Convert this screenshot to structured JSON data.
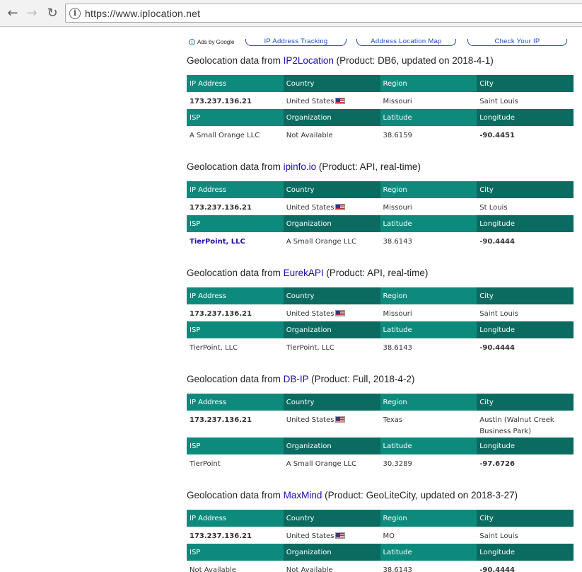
{
  "browser": {
    "url": "https://www.iplocation.net"
  },
  "ads": {
    "label": "Ads by Google",
    "links": [
      "IP Address Tracking",
      "Address Location Map",
      "Check Your IP"
    ]
  },
  "headers": {
    "ip": "IP Address",
    "country": "Country",
    "region": "Region",
    "city": "City",
    "isp": "ISP",
    "org": "Organization",
    "lat": "Latitude",
    "lon": "Longitude"
  },
  "title_prefix": "Geolocation data from ",
  "sections": [
    {
      "source": "IP2Location",
      "product": "(Product: DB6, updated on 2018-4-1)",
      "ip": "173.237.136.21",
      "country": "United States",
      "region": "Missouri",
      "city": "Saint Louis",
      "isp": "A Small Orange LLC",
      "org": "Not Available",
      "lat": "38.6159",
      "lon": "-90.4451"
    },
    {
      "source": "ipinfo.io",
      "product": "(Product: API, real-time)",
      "ip": "173.237.136.21",
      "country": "United States",
      "region": "Missouri",
      "city": "St Louis",
      "isp": "TierPoint, LLC",
      "org": "A Small Orange LLC",
      "lat": "38.6143",
      "lon": "-90.4444"
    },
    {
      "source": "EurekAPI",
      "product": "(Product: API, real-time)",
      "ip": "173.237.136.21",
      "country": "United States",
      "region": "Missouri",
      "city": "Saint Louis",
      "isp": "TierPoint, LLC",
      "org": "TierPoint, LLC",
      "lat": "38.6143",
      "lon": "-90.4444"
    },
    {
      "source": "DB-IP",
      "product": "(Product: Full, 2018-4-2)",
      "ip": "173.237.136.21",
      "country": "United States",
      "region": "Texas",
      "city": "Austin (Walnut Creek Business Park)",
      "isp": "TierPoint",
      "org": "A Small Orange LLC",
      "lat": "30.3289",
      "lon": "-97.6726"
    },
    {
      "source": "MaxMind",
      "product": "(Product: GeoLiteCity, updated on 2018-3-27)",
      "ip": "173.237.136.21",
      "country": "United States",
      "region": "MO",
      "city": "Saint Louis",
      "isp": "Not Available",
      "org": "Not Available",
      "lat": "38.6143",
      "lon": "-90.4444"
    }
  ]
}
